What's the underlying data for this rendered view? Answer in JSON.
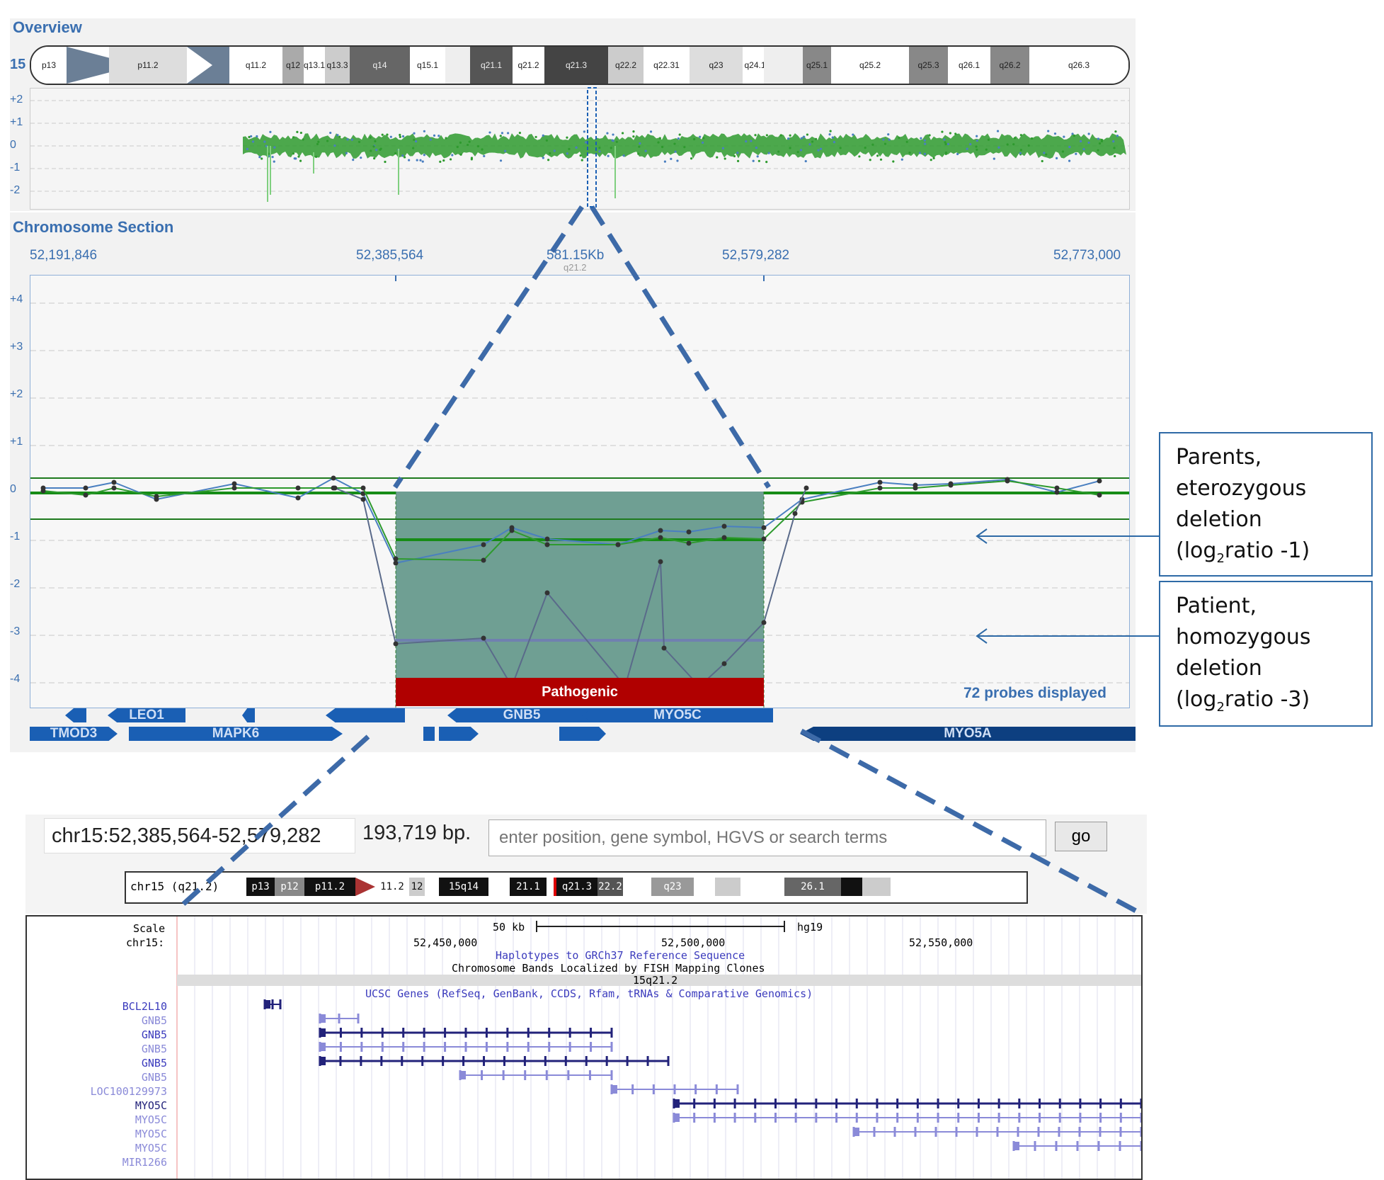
{
  "overview": {
    "title": "Overview",
    "chromosome": "15",
    "bands": [
      "p13",
      "p11.2",
      "q11.2",
      "q12",
      "q13.1",
      "q13.3",
      "q14",
      "q15.1",
      "q21.1",
      "q21.2",
      "q21.3",
      "q22.2",
      "q22.31",
      "q23",
      "q24.1",
      "q25.1",
      "q25.2",
      "q25.3",
      "q26.1",
      "q26.2",
      "q26.3"
    ],
    "y_ticks": [
      "+2",
      "+1",
      "0",
      "-1",
      "-2"
    ]
  },
  "section": {
    "title": "Chromosome Section",
    "coords": [
      "52,191,846",
      "52,385,564",
      "581.15Kb",
      "52,579,282",
      "52,773,000"
    ],
    "band_label": "q21.2",
    "y_ticks": [
      "+4",
      "+3",
      "+2",
      "+1",
      "0",
      "-1",
      "-2",
      "-3",
      "-4"
    ],
    "pathogenic_label": "Pathogenic",
    "probes_label": "72 probes displayed",
    "genes_row1": [
      "LEO1",
      "GNB5",
      "MYO5C"
    ],
    "genes_row2": [
      "TMOD3",
      "MAPK6",
      "MYO5A"
    ]
  },
  "callouts": {
    "parents": {
      "line1": "Parents,",
      "line2": "eterozygous",
      "line3": "deletion",
      "line4a": "(log",
      "line4sub": "2",
      "line4b": "ratio -1)"
    },
    "patient": {
      "line1": "Patient,",
      "line2": "homozygous",
      "line3": "deletion",
      "line4a": "(log",
      "line4sub": "2",
      "line4b": "ratio -3)"
    }
  },
  "ucsc": {
    "position": "chr15:52,385,564-52,579,282",
    "size": "193,719 bp.",
    "search_placeholder": "enter position, gene symbol, HGVS or search terms",
    "go_label": "go",
    "ideogram_label": "chr15 (q21.2)",
    "ideogram_bands": [
      "p13",
      "p12",
      "p11.2",
      "11.2",
      "12",
      "15q14",
      "21.1",
      "q21.3",
      "22.2",
      "q23",
      "26.1"
    ],
    "scale_label": "Scale",
    "chr_label": "chr15:",
    "scale_value": "50 kb",
    "assembly": "hg19",
    "positions": [
      "52,450,000",
      "52,500,000",
      "52,550,000"
    ],
    "track_haplo": "Haplotypes to GRCh37 Reference Sequence",
    "track_bands": "Chromosome Bands Localized by FISH Mapping Clones",
    "band_value": "15q21.2",
    "track_genes": "UCSC Genes (RefSeq, GenBank, CCDS, Rfam, tRNAs & Comparative Genomics)",
    "gene_rows": [
      "BCL2L10",
      "GNB5",
      "GNB5",
      "GNB5",
      "GNB5",
      "GNB5",
      "LOC100129973",
      "MYO5C",
      "MYO5C",
      "MYO5C",
      "MYO5C",
      "MIR1266"
    ]
  },
  "colors": {
    "accent": "#3a6fb0",
    "gene": "#1a5fb4",
    "pathogenic": "#b00000",
    "deletion": "#6f9f93",
    "probe": "#2e9a2e"
  }
}
